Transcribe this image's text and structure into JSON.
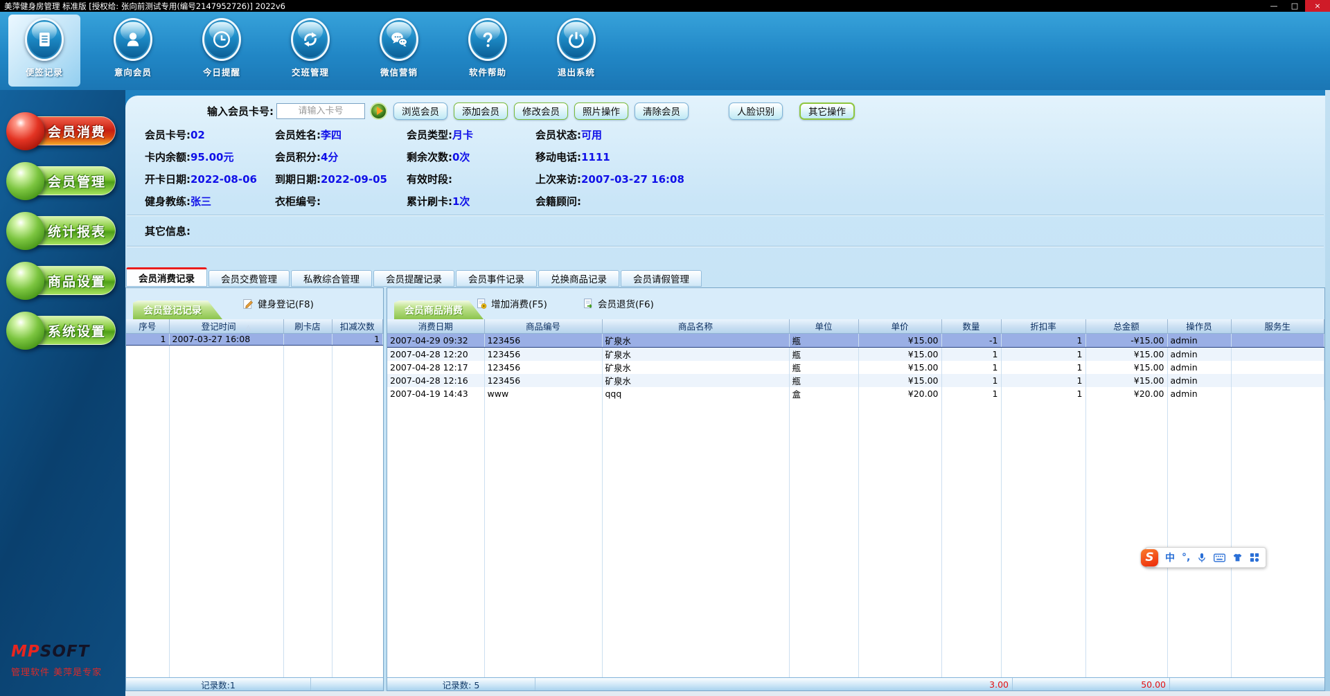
{
  "window": {
    "title": "美萍健身房管理 标准版 [授权给: 张向前测试专用(编号2147952726)]  2022v6",
    "controls": {
      "minimize": "—",
      "maximize": "□",
      "close": "×"
    }
  },
  "toolbar": {
    "items": [
      {
        "label": "便签记录",
        "icon": "note-icon",
        "selected": true
      },
      {
        "label": "意向会员",
        "icon": "member-icon",
        "selected": false
      },
      {
        "label": "今日提醒",
        "icon": "clock-icon",
        "selected": false
      },
      {
        "label": "交班管理",
        "icon": "shift-arrows-icon",
        "selected": false
      },
      {
        "label": "微信营销",
        "icon": "wechat-icon",
        "selected": false
      },
      {
        "label": "软件帮助",
        "icon": "help-icon",
        "selected": false
      },
      {
        "label": "退出系统",
        "icon": "power-icon",
        "selected": false
      }
    ]
  },
  "sidebar": {
    "items": [
      {
        "label": "会员消费",
        "color": "#e02415",
        "active": true
      },
      {
        "label": "会员管理",
        "color": "#6ab82e",
        "active": false
      },
      {
        "label": "统计报表",
        "color": "#6ab82e",
        "active": false
      },
      {
        "label": "商品设置",
        "color": "#6ab82e",
        "active": false
      },
      {
        "label": "系统设置",
        "color": "#6ab82e",
        "active": false
      }
    ],
    "logo_mp": "MP",
    "logo_soft": "SOFT",
    "slogan": "管理软件 美萍是专家"
  },
  "search": {
    "label": "输入会员卡号:",
    "placeholder": "请输入卡号",
    "buttons": [
      "浏览会员",
      "添加会员",
      "修改会员",
      "照片操作",
      "清除会员",
      "人脸识别",
      "其它操作"
    ]
  },
  "member": {
    "fields": [
      {
        "label": "会员卡号:",
        "value": "02"
      },
      {
        "label": "会员姓名:",
        "value": "李四"
      },
      {
        "label": "会员类型:",
        "value": "月卡"
      },
      {
        "label": "会员状态:",
        "value": "可用"
      },
      {
        "label": "卡内余额:",
        "value": "95.00元"
      },
      {
        "label": "会员积分:",
        "value": "4分"
      },
      {
        "label": "剩余次数:",
        "value": "0次"
      },
      {
        "label": "移动电话:",
        "value": "1111"
      },
      {
        "label": "开卡日期:",
        "value": "2022-08-06"
      },
      {
        "label": "到期日期:",
        "value": "2022-09-05"
      },
      {
        "label": "有效时段:",
        "value": ""
      },
      {
        "label": "上次来访:",
        "value": "2007-03-27 16:08"
      },
      {
        "label": "健身教练:",
        "value": "张三"
      },
      {
        "label": "衣柜编号:",
        "value": ""
      },
      {
        "label": "累计刷卡:",
        "value": "1次"
      },
      {
        "label": "会籍顾问:",
        "value": ""
      }
    ],
    "other_info_label": "其它信息:"
  },
  "tabs": [
    "会员消费记录",
    "会员交费管理",
    "私教综合管理",
    "会员提醒记录",
    "会员事件记录",
    "兑换商品记录",
    "会员请假管理"
  ],
  "left_panel": {
    "tab": "会员登记记录",
    "action": "健身登记(F8)",
    "sort_icon": "△",
    "columns": [
      "序号",
      "登记时间",
      "刷卡店",
      "扣减次数"
    ],
    "rows": [
      [
        "1",
        "2007-03-27 16:08",
        "",
        "1"
      ]
    ],
    "status": "记录数:1"
  },
  "right_panel": {
    "tab": "会员商品消费",
    "actions": [
      "增加消费(F5)",
      "会员退货(F6)"
    ],
    "columns": [
      "消费日期",
      "商品编号",
      "商品名称",
      "单位",
      "单价",
      "数量",
      "折扣率",
      "总金额",
      "操作员",
      "服务生"
    ],
    "rows": [
      [
        "2007-04-29 09:32",
        "123456",
        "矿泉水",
        "瓶",
        "¥15.00",
        "-1",
        "1",
        "-¥15.00",
        "admin",
        ""
      ],
      [
        "2007-04-28 12:20",
        "123456",
        "矿泉水",
        "瓶",
        "¥15.00",
        "1",
        "1",
        "¥15.00",
        "admin",
        ""
      ],
      [
        "2007-04-28 12:17",
        "123456",
        "矿泉水",
        "瓶",
        "¥15.00",
        "1",
        "1",
        "¥15.00",
        "admin",
        ""
      ],
      [
        "2007-04-28 12:16",
        "123456",
        "矿泉水",
        "瓶",
        "¥15.00",
        "1",
        "1",
        "¥15.00",
        "admin",
        ""
      ],
      [
        "2007-04-19 14:43",
        "www",
        "qqq",
        "盒",
        "¥20.00",
        "1",
        "1",
        "¥20.00",
        "admin",
        ""
      ]
    ],
    "status": "记录数: 5",
    "status_values": [
      "3.00",
      "50.00"
    ]
  },
  "ime": {
    "logo": "S",
    "mode": "中",
    "punct": "°,"
  },
  "colors": {
    "accent_blue": "#1e82c2",
    "value_blue": "#1010e8",
    "alert_red": "#e31212",
    "active_tab_red": "#ea1c1c"
  }
}
